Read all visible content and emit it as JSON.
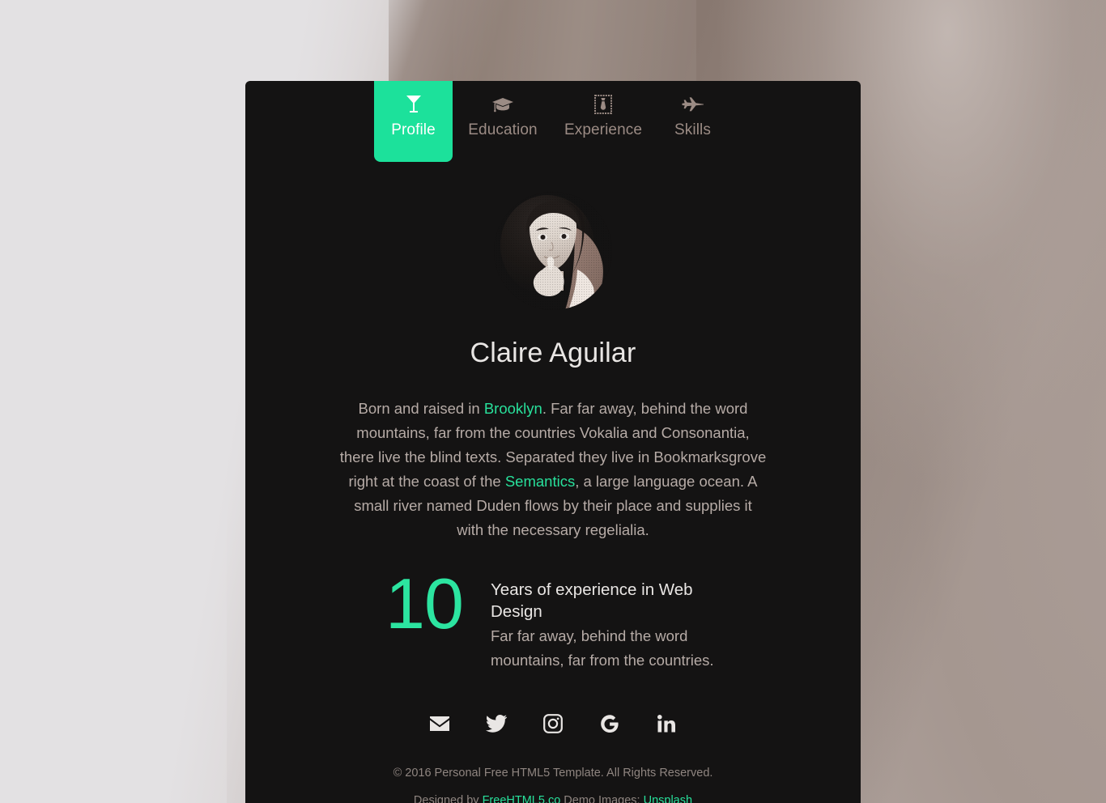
{
  "theme": {
    "accent_green": "#1ce19b",
    "card_background": "#141313",
    "page_background_left": "#e3e1e3",
    "page_background_right": "#8a7b72",
    "body_text": "#b6aba6",
    "heading_text": "#e9e6e4",
    "muted_text": "#9b8b84"
  },
  "nav": {
    "tabs": [
      {
        "label": "Profile",
        "icon": "cocktail-glass-icon",
        "active": true
      },
      {
        "label": "Education",
        "icon": "graduation-cap-icon",
        "active": false
      },
      {
        "label": "Experience",
        "icon": "necktie-icon",
        "active": false
      },
      {
        "label": "Skills",
        "icon": "jet-plane-icon",
        "active": false
      }
    ]
  },
  "profile": {
    "avatar_alt": "portrait-photo-of-claire-aguilar",
    "name": "Claire Aguilar",
    "bio": {
      "part1": "Born and raised in ",
      "link1": "Brooklyn",
      "part2": ". Far far away, behind the word mountains, far from the countries Vokalia and Consonantia, there live the blind texts. Separated they live in Bookmarksgrove right at the coast of the ",
      "link2": "Semantics",
      "part3": ", a large language ocean. A small river named Duden flows by their place and supplies it with the necessary regelialia."
    }
  },
  "experience": {
    "number": "10",
    "title": "Years of experience in Web Design",
    "description": "Far far away, behind the word mountains, far from the countries."
  },
  "socials": [
    {
      "name": "email-icon",
      "label": "Email"
    },
    {
      "name": "twitter-icon",
      "label": "Twitter"
    },
    {
      "name": "instagram-icon",
      "label": "Instagram"
    },
    {
      "name": "google-icon",
      "label": "Google"
    },
    {
      "name": "linkedin-icon",
      "label": "LinkedIn"
    }
  ],
  "footer": {
    "copyright": "© 2016 Personal Free HTML5 Template. All Rights Reserved.",
    "designed_by_prefix": "Designed by ",
    "designed_by_link": "FreeHTML5.co",
    "demo_images_prefix": " Demo Images: ",
    "demo_images_link": "Unsplash"
  }
}
